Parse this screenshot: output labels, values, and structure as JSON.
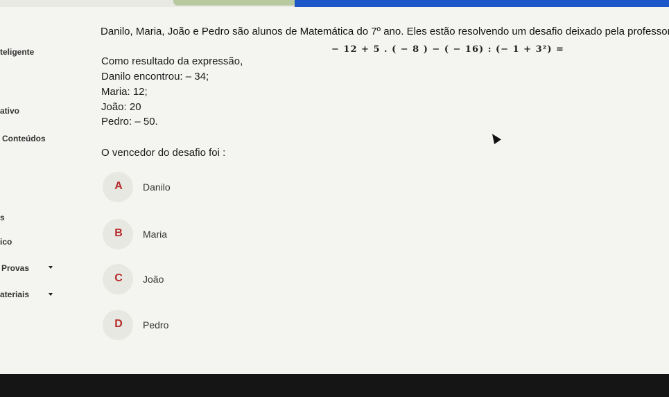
{
  "sidebar": {
    "items": [
      {
        "label": "teligente"
      },
      {
        "label": "ativo"
      },
      {
        "label": "Conteúdos"
      },
      {
        "label": "s"
      },
      {
        "label": "ico"
      },
      {
        "label": "Provas"
      },
      {
        "label": "ateriais"
      }
    ]
  },
  "question": {
    "intro": "Danilo, Maria, João e Pedro são alunos de Matemática do 7º ano. Eles estão resolvendo um desafio deixado pela professora M",
    "expression": "− 12 + 5 . ( − 8 ) − ( − 16) : (− 1 + 3²) =",
    "result_line": "Como resultado da expressão,",
    "answers": [
      "Danilo encontrou: – 34;",
      "Maria: 12;",
      "João: 20",
      "Pedro: – 50."
    ],
    "prompt": "O vencedor do desafio foi :"
  },
  "options": [
    {
      "letter": "A",
      "label": "Danilo"
    },
    {
      "letter": "B",
      "label": "Maria"
    },
    {
      "letter": "C",
      "label": "João"
    },
    {
      "letter": "D",
      "label": "Pedro"
    }
  ],
  "colors": {
    "accent_bar": "#1d56c7",
    "option_letter": "#b52b2b",
    "option_bubble": "#e8e8e3"
  }
}
